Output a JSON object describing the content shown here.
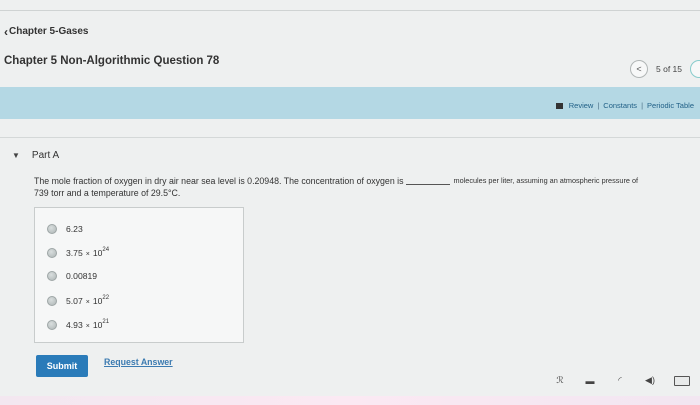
{
  "nav": {
    "back_label": "Chapter 5-Gases"
  },
  "header": {
    "title": "Chapter 5 Non-Algorithmic Question 78"
  },
  "pager": {
    "text": "5 of 15"
  },
  "toolbar": {
    "review": "Review",
    "sep": "|",
    "constants": "Constants",
    "periodic": "Periodic Table"
  },
  "part": {
    "label": "Part A"
  },
  "question": {
    "text_before": "The mole fraction of oxygen in dry air near sea level is 0.20948. The concentration of oxygen is",
    "text_after": "molecules per liter, assuming an atmospheric pressure of",
    "line2": "739 torr and a temperature of 29.5°C."
  },
  "options": [
    {
      "mantissa": "6.23",
      "exp": ""
    },
    {
      "mantissa": "3.75",
      "times": "×",
      "base": "10",
      "exp": "24"
    },
    {
      "mantissa": "0.00819",
      "exp": ""
    },
    {
      "mantissa": "5.07",
      "times": "×",
      "base": "10",
      "exp": "22"
    },
    {
      "mantissa": "4.93",
      "times": "×",
      "base": "10",
      "exp": "21"
    }
  ],
  "actions": {
    "submit": "Submit",
    "request_answer": "Request Answer"
  },
  "icons": {
    "back": "chevron-left-icon",
    "prev": "chevron-left-icon",
    "caret": "caret-down-icon",
    "book": "book-icon",
    "taskbar": [
      "people-icon",
      "battery-icon",
      "wifi-icon",
      "volume-icon",
      "keyboard-icon"
    ]
  },
  "colors": {
    "accent": "#2a7bb9",
    "bar": "#b4d8e4",
    "link": "#3c7bb1"
  }
}
